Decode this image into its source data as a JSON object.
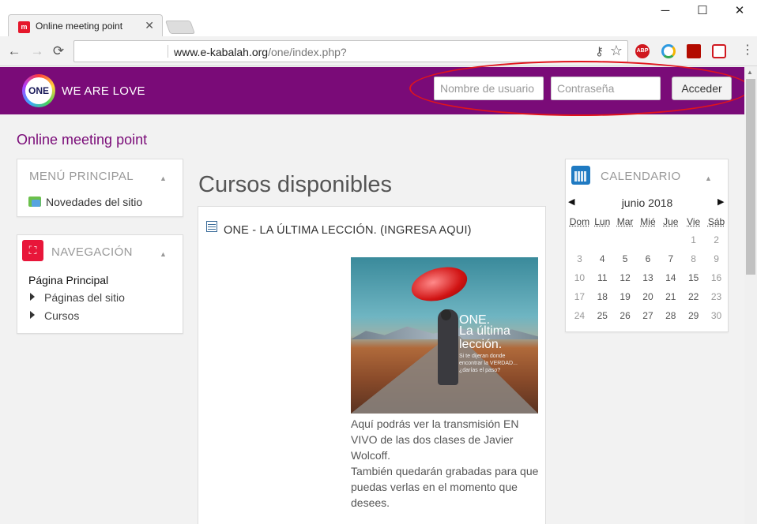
{
  "browser": {
    "tab_title": "Online meeting point",
    "tab_close": "✕",
    "favicon_glyph": "m",
    "window_controls": {
      "minimize": "─",
      "maximize": "☐",
      "close": "✕"
    },
    "nav": {
      "back": "←",
      "forward": "→",
      "reload": "⟳"
    },
    "url_host": "www.e-kabalah.org",
    "url_path": "/one/index.php?",
    "key_icon": "⚷",
    "star_icon": "☆",
    "extensions": {
      "abp": "ABP",
      "menu": "⋮"
    },
    "colors": {
      "chrome_bg": "#f2f2f2",
      "tab_border": "#c9c9c9"
    }
  },
  "header": {
    "logo_text": "ONE",
    "brand": "WE ARE LOVE",
    "username_placeholder": "Nombre de usuario",
    "password_placeholder": "Contraseña",
    "login_button": "Acceder",
    "colors": {
      "brand_purple": "#7a0b78",
      "highlight_ellipse": "#e0141c"
    }
  },
  "page": {
    "site_title": "Online meeting point"
  },
  "main_menu": {
    "title": "MENÚ PRINCIPAL",
    "caret": "▲",
    "items": [
      {
        "label": "Novedades del sitio",
        "icon": "news-icon"
      }
    ]
  },
  "navigation": {
    "title": "NAVEGACIÓN",
    "caret": "▲",
    "icon_glyph": "⛶",
    "home": "Página Principal",
    "items": [
      {
        "label": "Páginas del sitio"
      },
      {
        "label": "Cursos"
      }
    ]
  },
  "courses": {
    "heading": "Cursos disponibles",
    "course_title": "ONE - LA ÚLTIMA LECCIÓN. (INGRESA AQUI)",
    "image_caption": {
      "line1": "ONE.",
      "line2": "La última",
      "line3": "lección.",
      "small1": "Si te dijeran donde",
      "small2": "encontrar la VERDAD...",
      "small3": "¿darías el paso?"
    },
    "summary_1": "Aquí podrás ver la transmisión EN VIVO de las dos clases de Javier Wolcoff.",
    "summary_2": "También quedarán grabadas para que puedas verlas en el momento que desees."
  },
  "calendar": {
    "title": "CALENDARIO",
    "caret": "▲",
    "prev": "◀",
    "next": "▶",
    "month": "junio 2018",
    "weekdays": [
      "Dom",
      "Lun",
      "Mar",
      "Mié",
      "Jue",
      "Vie",
      "Sáb"
    ],
    "weeks": [
      [
        "",
        "",
        "",
        "",
        "",
        "1",
        "2"
      ],
      [
        "3",
        "4",
        "5",
        "6",
        "7",
        "8",
        "9"
      ],
      [
        "10",
        "11",
        "12",
        "13",
        "14",
        "15",
        "16"
      ],
      [
        "17",
        "18",
        "19",
        "20",
        "21",
        "22",
        "23"
      ],
      [
        "24",
        "25",
        "26",
        "27",
        "28",
        "29",
        "30"
      ]
    ],
    "colors": {
      "icon_blue": "#1f7ac2"
    }
  }
}
